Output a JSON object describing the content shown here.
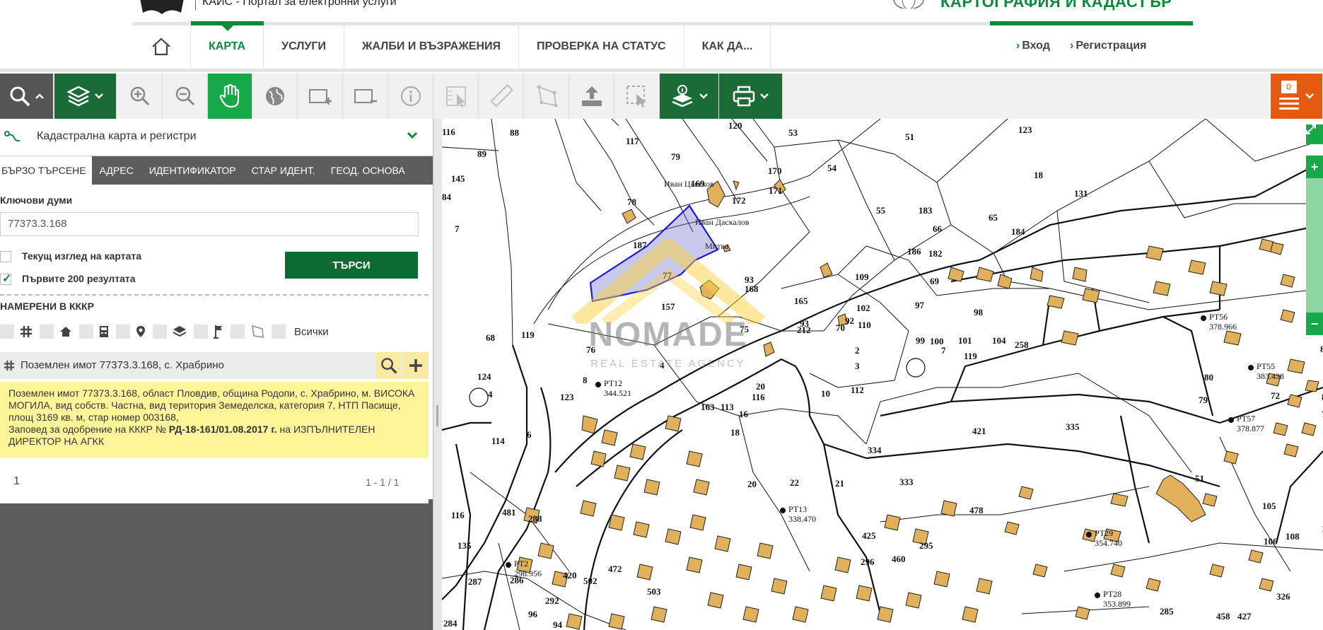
{
  "header": {
    "portal_title": "КАИС - Портал за електронни услуги",
    "agency_title": "КАРТОГРАФИЯ И КАДАСТЪР",
    "nav": [
      {
        "label": "КАРТА"
      },
      {
        "label": "УСЛУГИ"
      },
      {
        "label": "ЖАЛБИ И ВЪЗРАЖЕНИЯ"
      },
      {
        "label": "ПРОВЕРКА НА СТАТУС"
      },
      {
        "label": "КАК ДА..."
      }
    ],
    "login": "Вход",
    "register": "Регистрация"
  },
  "toolbar": {
    "tools": [
      "search-icon",
      "layers-icon",
      "zoom-in-icon",
      "zoom-out-icon",
      "pan-hand-icon",
      "globe-icon",
      "add-frame-icon",
      "remove-frame-icon",
      "info-icon",
      "ruler-area-icon",
      "ruler-icon",
      "polygon-icon",
      "upload-icon",
      "select-icon",
      "layer-info-icon",
      "print-icon"
    ],
    "counter": "0"
  },
  "panel": {
    "title": "Кадастрална карта и регистри",
    "tabs": [
      {
        "label": "БЪРЗО ТЪРСЕНЕ"
      },
      {
        "label": "АДРЕС"
      },
      {
        "label": "ИДЕНТИФИКАТОР"
      },
      {
        "label": "СТАР ИДЕНТ."
      },
      {
        "label": "ГЕОД. ОСНОВА"
      }
    ],
    "keywords_label": "Ключови думи",
    "keywords_value": "77373.3.168",
    "current_view_label": "Текущ изглед на картата",
    "first200_label": "Първите 200 резултата",
    "search_button": "ТЪРСИ",
    "found_label": "НАМЕРЕНИ В КККР",
    "all_label": "Всички",
    "result": {
      "title": "Поземлен имот 77373.3.168, с. Храбрино",
      "desc_line1": "Поземлен имот 77373.3.168, област Пловдив, община Родопи, с. Храбрино, м. ВИСОКА МОГИЛА, вид собств. Частна, вид територия Земеделска, категория 7, НТП Пасище, площ 3169 кв. м, стар номер 003168,",
      "desc_order_prefix": "Заповед за одобрение на КККР № ",
      "desc_order_num": "РД-18-161/01.08.2017 г.",
      "desc_order_suffix": " на ИЗПЪЛНИТЕЛЕН ДИРЕКТОР НА АГКК"
    },
    "pager": {
      "page": "1",
      "count": "1 - 1 / 1"
    }
  },
  "map": {
    "watermark_name": "NOMADE",
    "watermark_sub": "REAL ESTATE AGENCY",
    "highlight_lot": "168",
    "lots": [
      {
        "n": "116"
      },
      {
        "n": "88"
      },
      {
        "n": "89"
      },
      {
        "n": "145"
      },
      {
        "n": "84"
      },
      {
        "n": "7"
      },
      {
        "n": "117"
      },
      {
        "n": "79"
      },
      {
        "n": "120"
      },
      {
        "n": "53"
      },
      {
        "n": "51"
      },
      {
        "n": "123"
      },
      {
        "n": "78"
      },
      {
        "n": "169"
      },
      {
        "n": "172"
      },
      {
        "n": "170"
      },
      {
        "n": "171"
      },
      {
        "n": "54"
      },
      {
        "n": "18"
      },
      {
        "n": "131"
      },
      {
        "n": "55"
      },
      {
        "n": "183"
      },
      {
        "n": "65"
      },
      {
        "n": "66"
      },
      {
        "n": "184"
      },
      {
        "n": "186"
      },
      {
        "n": "182"
      },
      {
        "n": "187"
      },
      {
        "n": "77"
      },
      {
        "n": "157"
      },
      {
        "n": "93"
      },
      {
        "n": "168"
      },
      {
        "n": "165"
      },
      {
        "n": "109"
      },
      {
        "n": "110"
      },
      {
        "n": "70"
      },
      {
        "n": "69"
      },
      {
        "n": "68"
      },
      {
        "n": "119"
      },
      {
        "n": "76"
      },
      {
        "n": "4"
      },
      {
        "n": "75"
      },
      {
        "n": "212"
      },
      {
        "n": "2"
      },
      {
        "n": "3"
      },
      {
        "n": "7"
      },
      {
        "n": "119"
      },
      {
        "n": "124"
      },
      {
        "n": "104"
      },
      {
        "n": "8"
      },
      {
        "n": "20"
      },
      {
        "n": "112"
      },
      {
        "n": "116"
      },
      {
        "n": "10"
      },
      {
        "n": "16"
      },
      {
        "n": "123"
      },
      {
        "n": "163"
      },
      {
        "n": "113"
      },
      {
        "n": "18"
      },
      {
        "n": "114"
      },
      {
        "n": "6"
      },
      {
        "n": "421"
      },
      {
        "n": "335"
      },
      {
        "n": "334"
      },
      {
        "n": "20"
      },
      {
        "n": "22"
      },
      {
        "n": "21"
      },
      {
        "n": "333"
      },
      {
        "n": "478"
      },
      {
        "n": "481"
      },
      {
        "n": "116"
      },
      {
        "n": "288"
      },
      {
        "n": "135"
      },
      {
        "n": "287"
      },
      {
        "n": "286"
      },
      {
        "n": "420"
      },
      {
        "n": "292"
      },
      {
        "n": "503"
      },
      {
        "n": "502"
      },
      {
        "n": "472"
      },
      {
        "n": "425"
      },
      {
        "n": "296"
      },
      {
        "n": "295"
      },
      {
        "n": "460"
      },
      {
        "n": "51"
      },
      {
        "n": "105"
      },
      {
        "n": "106"
      },
      {
        "n": "108"
      },
      {
        "n": "354"
      },
      {
        "n": "326"
      },
      {
        "n": "458"
      },
      {
        "n": "427"
      },
      {
        "n": "285"
      },
      {
        "n": "284"
      },
      {
        "n": "96"
      },
      {
        "n": "94"
      },
      {
        "n": "93"
      },
      {
        "n": "92"
      },
      {
        "n": "102"
      },
      {
        "n": "97"
      },
      {
        "n": "98"
      },
      {
        "n": "99"
      },
      {
        "n": "100"
      },
      {
        "n": "101"
      },
      {
        "n": "104"
      },
      {
        "n": "258"
      },
      {
        "n": "80"
      },
      {
        "n": "79"
      },
      {
        "n": "88"
      },
      {
        "n": "71"
      },
      {
        "n": "72"
      },
      {
        "n": "87"
      }
    ],
    "names": [
      {
        "t": "Иван Цветков"
      },
      {
        "t": "Иван Даскалов"
      },
      {
        "t": "Митва"
      }
    ],
    "rt_points": [
      {
        "t": "РТ12",
        "v": "344.521"
      },
      {
        "t": "РТ13",
        "v": "338.470"
      },
      {
        "t": "РТ2",
        "v": "298.956"
      },
      {
        "t": "РТ29",
        "v": "354.740"
      },
      {
        "t": "РТ28",
        "v": "353.899"
      },
      {
        "t": "РТ56",
        "v": "378.966"
      },
      {
        "t": "РТ55",
        "v": "383.438"
      },
      {
        "t": "РТ57",
        "v": "378.877"
      }
    ]
  }
}
